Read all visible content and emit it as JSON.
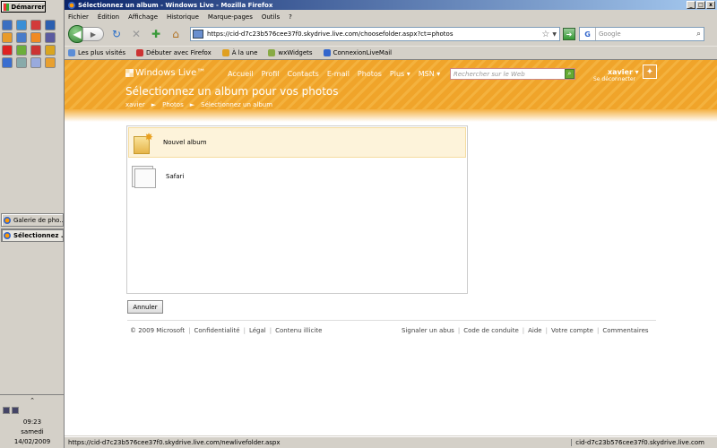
{
  "taskbar": {
    "start_label": "Démarrer",
    "quick_launch_colors": [
      "#3b6fc1",
      "#3a8fd6",
      "#d23a3a",
      "#2b5fb0",
      "#e89b2a",
      "#4a7cc9",
      "#f08a24",
      "#5a5aa0",
      "#d22",
      "#6cae3b",
      "#c33",
      "#d9a520",
      "#3a6ed0",
      "#8aa",
      "#9ad",
      "#e8a030"
    ],
    "tasks": [
      {
        "label": "Galerie de pho..."
      },
      {
        "label": "Sélectionnez ..."
      }
    ],
    "tray": {
      "time": "09:23",
      "day": "samedi",
      "date": "14/02/2009"
    }
  },
  "window": {
    "title": "Sélectionnez un album - Windows Live - Mozilla Firefox",
    "buttons": [
      "_",
      "□",
      "x"
    ]
  },
  "menu": [
    "Fichier",
    "Édition",
    "Affichage",
    "Historique",
    "Marque-pages",
    "Outils",
    "?"
  ],
  "navbar": {
    "url": "https://cid-d7c23b576cee37f0.skydrive.live.com/choosefolder.aspx?ct=photos",
    "search_placeholder": "Google",
    "search_engine_letter": "G"
  },
  "bookmarks": [
    {
      "label": "Les plus visités",
      "color": "#5b8dd6"
    },
    {
      "label": "Débuter avec Firefox",
      "color": "#c33"
    },
    {
      "label": "À la une",
      "color": "#e0a020"
    },
    {
      "label": "wxWidgets",
      "color": "#8a4"
    },
    {
      "label": "ConnexionLiveMail",
      "color": "#36c"
    }
  ],
  "banner": {
    "brand": "Windows Live™",
    "nav": [
      "Accueil",
      "Profil",
      "Contacts",
      "E-mail",
      "Photos",
      "Plus ▾",
      "MSN ▾"
    ],
    "search_placeholder": "Rechercher sur le Web",
    "user": "xavier ▾",
    "signout": "Se déconnecter",
    "page_title": "Sélectionnez un album pour vos photos",
    "breadcrumb": [
      "xavier",
      "►",
      "Photos",
      "►",
      "Sélectionnez un album"
    ]
  },
  "albums": [
    {
      "label": "Nouvel album"
    },
    {
      "label": "Safari"
    }
  ],
  "cancel_label": "Annuler",
  "footer": {
    "left": [
      "© 2009 Microsoft",
      "Confidentialité",
      "Légal",
      "Contenu illicite"
    ],
    "right": [
      "Signaler un abus",
      "Code de conduite",
      "Aide",
      "Votre compte",
      "Commentaires"
    ]
  },
  "status": {
    "left": "https://cid-d7c23b576cee37f0.skydrive.live.com/newlivefolder.aspx",
    "right": "cid-d7c23b576cee37f0.skydrive.live.com"
  }
}
